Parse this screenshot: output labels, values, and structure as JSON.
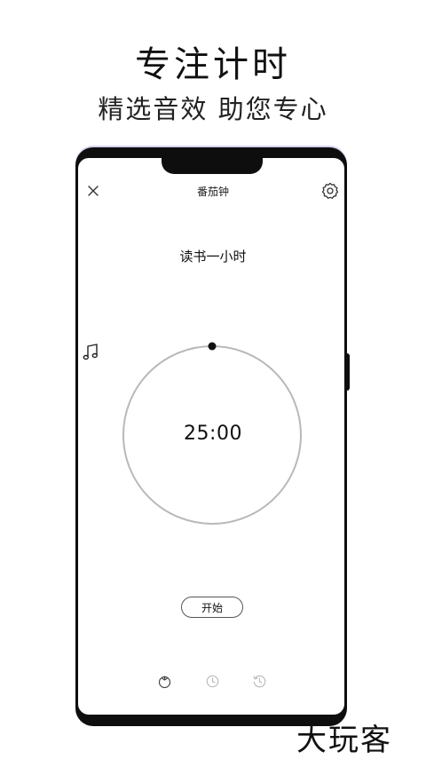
{
  "promo": {
    "title": "专注计时",
    "subtitle": "精选音效 助您专心"
  },
  "app": {
    "title": "番茄钟",
    "session_title": "读书一小时",
    "timer_value": "25:00",
    "start_label": "开始"
  },
  "icons": {
    "close": "close-icon",
    "settings": "gear-icon",
    "music": "music-note-icon",
    "tab_tomato": "tomato-icon",
    "tab_clock": "clock-icon",
    "tab_history": "history-icon"
  },
  "watermark": "大玩客",
  "colors": {
    "ring": "#b8b8b8",
    "accent_dot": "#111111",
    "phone_frame": "#0e0e0e"
  }
}
